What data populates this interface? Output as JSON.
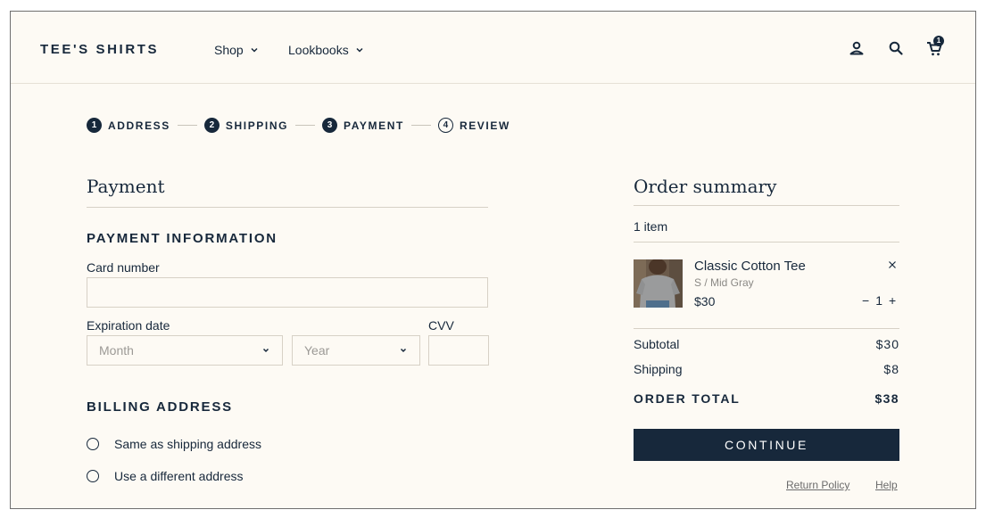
{
  "header": {
    "brand": "TEE'S SHIRTS",
    "nav": [
      {
        "label": "Shop"
      },
      {
        "label": "Lookbooks"
      }
    ],
    "icons": [
      "account-icon",
      "search-icon",
      "cart-icon"
    ],
    "cart_count": "1"
  },
  "stepper": {
    "steps": [
      {
        "num": "1",
        "label": "ADDRESS",
        "state": "complete"
      },
      {
        "num": "2",
        "label": "SHIPPING",
        "state": "complete"
      },
      {
        "num": "3",
        "label": "PAYMENT",
        "state": "current"
      },
      {
        "num": "4",
        "label": "REVIEW",
        "state": "upcoming"
      }
    ]
  },
  "payment": {
    "title": "Payment",
    "info_heading": "PAYMENT INFORMATION",
    "card_number_label": "Card number",
    "card_number_value": "",
    "expiration_label": "Expiration date",
    "month_placeholder": "Month",
    "year_placeholder": "Year",
    "cvv_label": "CVV",
    "cvv_value": "",
    "billing_heading": "BILLING ADDRESS",
    "billing_options": [
      {
        "label": "Same as shipping address",
        "selected": false
      },
      {
        "label": "Use a different address",
        "selected": false
      }
    ]
  },
  "summary": {
    "title": "Order summary",
    "item_count": "1 item",
    "item": {
      "name": "Classic Cotton Tee",
      "variant": "S / Mid Gray",
      "price": "$30",
      "quantity": "1",
      "minus": "−",
      "plus": "+"
    },
    "subtotal_label": "Subtotal",
    "subtotal_value": "$30",
    "shipping_label": "Shipping",
    "shipping_value": "$8",
    "total_label": "ORDER TOTAL",
    "total_value": "$38",
    "continue_label": "CONTINUE",
    "links": {
      "return_policy": "Return Policy",
      "help": "Help"
    }
  },
  "colors": {
    "navy": "#17283b",
    "background": "#fdfaf4",
    "border": "#d7d1c6",
    "muted": "#8b8985"
  }
}
